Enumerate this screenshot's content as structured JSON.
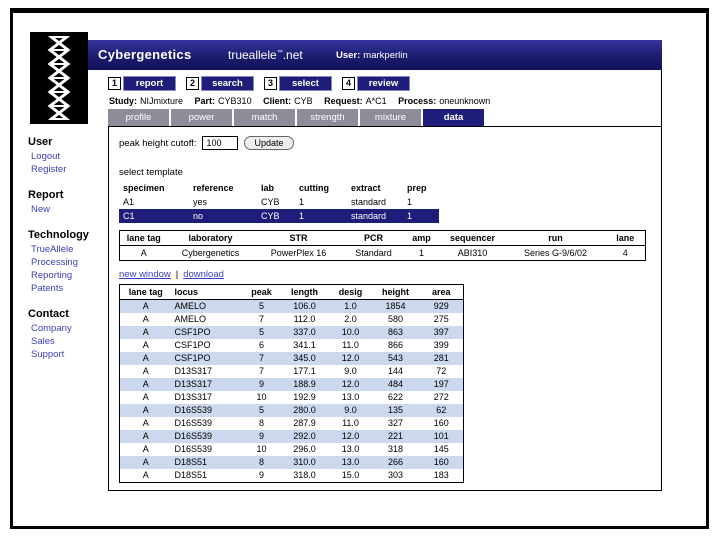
{
  "header": {
    "brand": "Cybergenetics",
    "site_pre": "trueallele",
    "site_sup": "™",
    "site_post": ".net",
    "user_label": "User:",
    "user_value": "markperlin"
  },
  "steps": [
    {
      "num": "1",
      "label": "report"
    },
    {
      "num": "2",
      "label": "search"
    },
    {
      "num": "3",
      "label": "select"
    },
    {
      "num": "4",
      "label": "review"
    }
  ],
  "status": [
    {
      "label": "Study:",
      "value": "NIJmixture"
    },
    {
      "label": "Part:",
      "value": "CYB310"
    },
    {
      "label": "Client:",
      "value": "CYB"
    },
    {
      "label": "Request:",
      "value": "A*C1"
    },
    {
      "label": "Process:",
      "value": "oneunknown"
    }
  ],
  "tabs": [
    "profile",
    "power",
    "match",
    "strength",
    "mixture",
    "data"
  ],
  "selected_tab": "data",
  "sidebar": {
    "sections": [
      {
        "title": "User",
        "links": [
          "Logout",
          "Register"
        ]
      },
      {
        "title": "Report",
        "links": [
          "New"
        ]
      },
      {
        "title": "Technology",
        "links": [
          "TrueAllele",
          "Processing",
          "Reporting",
          "Patents"
        ]
      },
      {
        "title": "Contact",
        "links": [
          "Company",
          "Sales",
          "Support"
        ]
      }
    ]
  },
  "main": {
    "cutoff_label": "peak height cutoff:",
    "cutoff_value": "100",
    "update_label": "Update",
    "select_template_label": "select template",
    "template_table": {
      "headers": [
        "specimen",
        "reference",
        "lab",
        "cutting",
        "extract",
        "prep"
      ],
      "selected_index": 1,
      "rows": [
        [
          "A1",
          "yes",
          "CYB",
          "1",
          "standard",
          "1"
        ],
        [
          "C1",
          "no",
          "CYB",
          "1",
          "standard",
          "1"
        ]
      ]
    },
    "lane_table": {
      "headers": [
        "lane tag",
        "laboratory",
        "STR",
        "PCR",
        "amp",
        "sequencer",
        "run",
        "lane"
      ],
      "rows": [
        [
          "A",
          "Cybergenetics",
          "PowerPlex 16",
          "Standard",
          "1",
          "ABI310",
          "Series G-9/6/02",
          "4"
        ]
      ]
    },
    "links": {
      "new_window": "new window",
      "separator": "|",
      "download": "download"
    },
    "data_table": {
      "headers": [
        "lane tag",
        "locus",
        "peak",
        "length",
        "desig",
        "height",
        "area"
      ],
      "rows": [
        [
          "A",
          "AMELO",
          "5",
          "106.0",
          "1.0",
          "1854",
          "929"
        ],
        [
          "A",
          "AMELO",
          "7",
          "112.0",
          "2.0",
          "580",
          "275"
        ],
        [
          "A",
          "CSF1PO",
          "5",
          "337.0",
          "10.0",
          "863",
          "397"
        ],
        [
          "A",
          "CSF1PO",
          "6",
          "341.1",
          "11.0",
          "866",
          "399"
        ],
        [
          "A",
          "CSF1PO",
          "7",
          "345.0",
          "12.0",
          "543",
          "281"
        ],
        [
          "A",
          "D13S317",
          "7",
          "177.1",
          "9.0",
          "144",
          "72"
        ],
        [
          "A",
          "D13S317",
          "9",
          "188.9",
          "12.0",
          "484",
          "197"
        ],
        [
          "A",
          "D13S317",
          "10",
          "192.9",
          "13.0",
          "622",
          "272"
        ],
        [
          "A",
          "D16S539",
          "5",
          "280.0",
          "9.0",
          "135",
          "62"
        ],
        [
          "A",
          "D16S539",
          "8",
          "287.9",
          "11.0",
          "327",
          "160"
        ],
        [
          "A",
          "D16S539",
          "9",
          "292.0",
          "12.0",
          "221",
          "101"
        ],
        [
          "A",
          "D16S539",
          "10",
          "296.0",
          "13.0",
          "318",
          "145"
        ],
        [
          "A",
          "D18S51",
          "8",
          "310.0",
          "13.0",
          "266",
          "160"
        ],
        [
          "A",
          "D18S51",
          "9",
          "318.0",
          "15.0",
          "303",
          "183"
        ]
      ]
    }
  }
}
